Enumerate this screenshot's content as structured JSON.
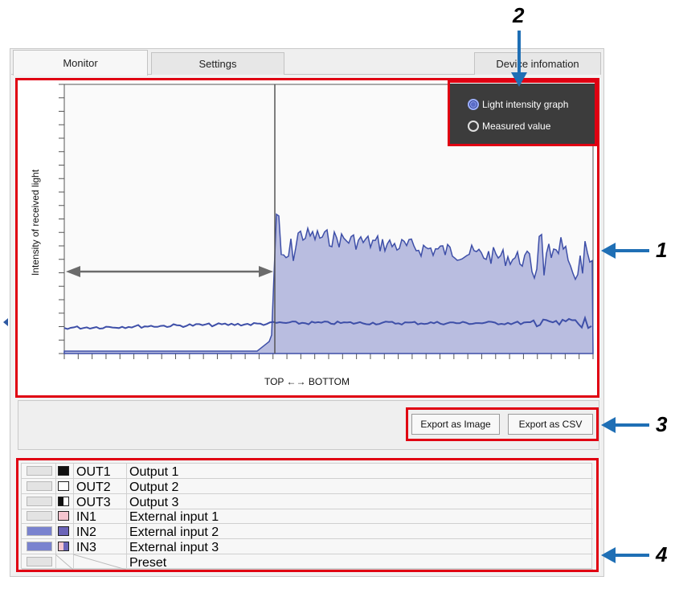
{
  "tabs": [
    {
      "label": "Monitor",
      "active": true
    },
    {
      "label": "Settings",
      "active": false
    },
    {
      "label": "Device infomation",
      "active": false
    }
  ],
  "graph": {
    "ylabel": "Intensity of received light",
    "xlabel": "TOP ←→ BOTTOM"
  },
  "mode": {
    "options": [
      {
        "label": "Light intensity graph",
        "selected": true
      },
      {
        "label": "Measured value",
        "selected": false
      }
    ]
  },
  "export": {
    "image_label": "Export as Image",
    "csv_label": "Export as CSV"
  },
  "io_rows": [
    {
      "code": "OUT1",
      "name": "Output 1",
      "led_on": false,
      "swatch": "black"
    },
    {
      "code": "OUT2",
      "name": "Output 2",
      "led_on": false,
      "swatch": "white"
    },
    {
      "code": "OUT3",
      "name": "Output 3",
      "led_on": false,
      "swatch": "half"
    },
    {
      "code": "IN1",
      "name": "External input 1",
      "led_on": false,
      "swatch": "pink"
    },
    {
      "code": "IN2",
      "name": "External input 2",
      "led_on": true,
      "swatch": "purple"
    },
    {
      "code": "IN3",
      "name": "External input 3",
      "led_on": true,
      "swatch": "pinkpurple"
    },
    {
      "code": "",
      "name": "Preset",
      "led_on": false,
      "swatch": "none"
    }
  ],
  "callouts": {
    "one": "1",
    "two": "2",
    "three": "3",
    "four": "4"
  },
  "colors": {
    "highlight": "#e00012",
    "callout_arrow": "#1f6fb5",
    "fill": "#b9bde0",
    "line": "#3e4fa8",
    "led_on": "#7a83cf"
  }
}
